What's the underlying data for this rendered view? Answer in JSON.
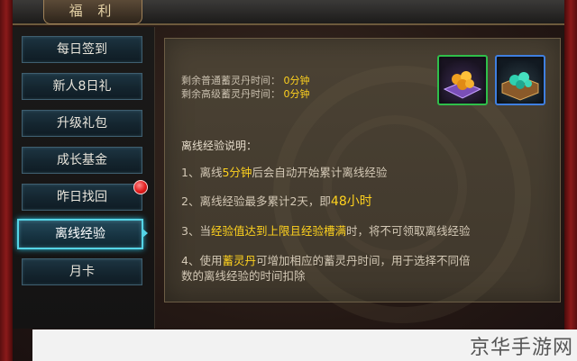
{
  "window": {
    "title": "福 利"
  },
  "sidebar": {
    "items": [
      {
        "label": "每日签到",
        "active": false
      },
      {
        "label": "新人8日礼",
        "active": false
      },
      {
        "label": "升级礼包",
        "active": false
      },
      {
        "label": "成长基金",
        "active": false
      },
      {
        "label": "昨日找回",
        "active": false,
        "has_notification": true
      },
      {
        "label": "离线经验",
        "active": true
      },
      {
        "label": "月卡",
        "active": false
      }
    ]
  },
  "content": {
    "remaining": [
      {
        "label": "剩余普通蓄灵丹时间：",
        "value": "0分钟"
      },
      {
        "label": "剩余高级蓄灵丹时间：",
        "value": "0分钟"
      }
    ],
    "icons": [
      {
        "name": "spirit-pill-normal-icon",
        "border_color": "#2fbf4a"
      },
      {
        "name": "spirit-pill-advanced-icon",
        "border_color": "#3f7fe0"
      }
    ],
    "section_title": "离线经验说明：",
    "rules": {
      "r1": {
        "a": "1、离线",
        "b": "5分钟",
        "c": "后会自动开始累计离线经验"
      },
      "r2": {
        "a": "2、离线经验最多累计2天，即",
        "b": "48小时"
      },
      "r3": {
        "a": "3、当",
        "b": "经验值达到上限且经验槽满",
        "c": "时，将不可领取离线经验"
      },
      "r4": {
        "a": "4、使用",
        "b": "蓄灵丹",
        "c": "可增加相应的蓄灵丹时间，用于选择不同倍",
        "d": "数的离线经验的时间扣除"
      }
    }
  },
  "watermark": "京华手游网",
  "colors": {
    "highlight": "#ffd21e",
    "active_border": "#55d4e6",
    "notification": "#e21b1b"
  }
}
